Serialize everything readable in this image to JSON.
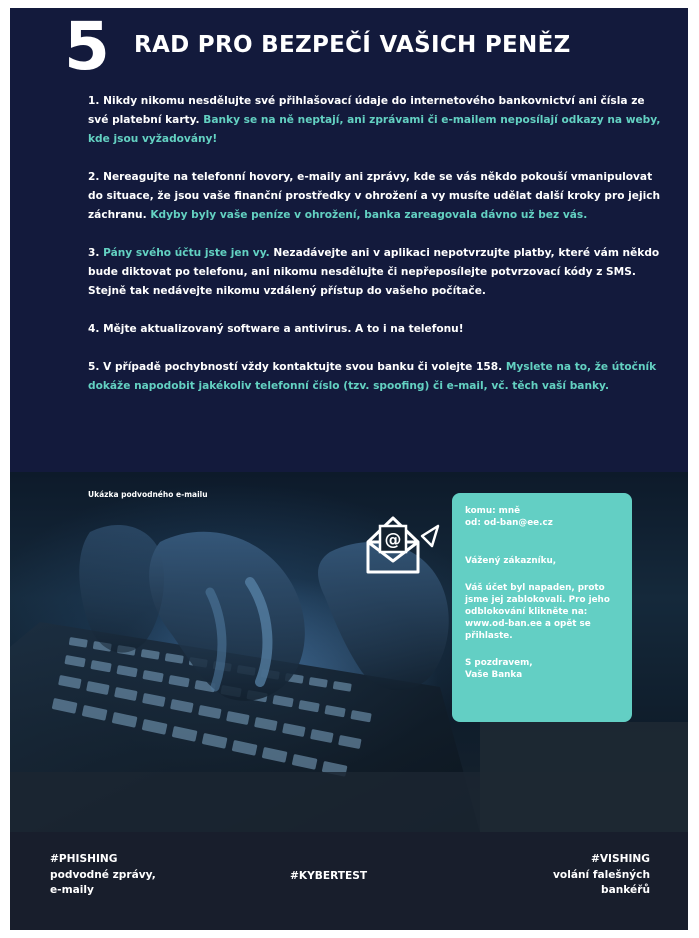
{
  "header": {
    "number": "5",
    "title": "RAD PRO BEZPEČÍ VAŠICH PENĚZ"
  },
  "rules": [
    {
      "text": "1. Nikdy nikomu nesdělujte své přihlašovací údaje do internetového bankovnictví ani čísla ze své platební karty. ",
      "highlight": "Banky se na ně neptají, ani zprávami či e-mailem neposílají odkazy na weby, kde jsou vyžadovány!"
    },
    {
      "text": "2. Nereagujte na telefonní hovory, e-maily ani zprávy, kde se vás někdo pokouší vmanipulovat do situace, že jsou vaše finanční prostředky v ohrožení a vy musíte udělat další kroky pro jejich záchranu. ",
      "highlight": "Kdyby byly vaše peníze v ohrožení, banka zareagovala dávno už bez vás."
    },
    {
      "pre": "3. ",
      "highlight": "Pány svého účtu jste jen vy.",
      "text": " Nezadávejte ani v aplikaci nepotvrzujte platby, které vám někdo bude diktovat po telefonu, ani nikomu nesdělujte či nepřeposílejte potvrzovací kódy z SMS. Stejně tak nedávejte nikomu vzdálený přístup do vašeho počítače."
    },
    {
      "text": "4. Mějte aktualizovaný software a antivirus. A to i na telefonu!"
    },
    {
      "text": "5. V případě pochybností vždy kontaktujte svou banku či volejte 158. ",
      "highlight": "Myslete na to, že útočník dokáže napodobit jakékoliv telefonní číslo (tzv. spoofing) či e-mail, vč. těch vaší banky."
    }
  ],
  "photo": {
    "label": "Ukázka podvodného e-mailu",
    "icon": "envelope-at-icon"
  },
  "email": {
    "to": "komu: mně",
    "from": "od: od-ban@ee.cz",
    "greeting": "Vážený zákazníku,",
    "body": "Váš účet byl napaden, proto jsme jej zablokovali. Pro jeho odblokování klikněte na: www.od-ban.ee a opět se přihlaste.",
    "closing": "S pozdravem,",
    "signature": "Vaše Banka"
  },
  "footer": {
    "left_title": "#PHISHING",
    "left_line1": "podvodné zprávy,",
    "left_line2": "e-maily",
    "center": "#KYBERTEST",
    "right_title": "#VISHING",
    "right_line1": "volání falešných",
    "right_line2": "bankéřů"
  },
  "colors": {
    "background": "#131a3c",
    "accent": "#63d1c2",
    "card": "#63cfc4",
    "footer": "#181e2c"
  }
}
